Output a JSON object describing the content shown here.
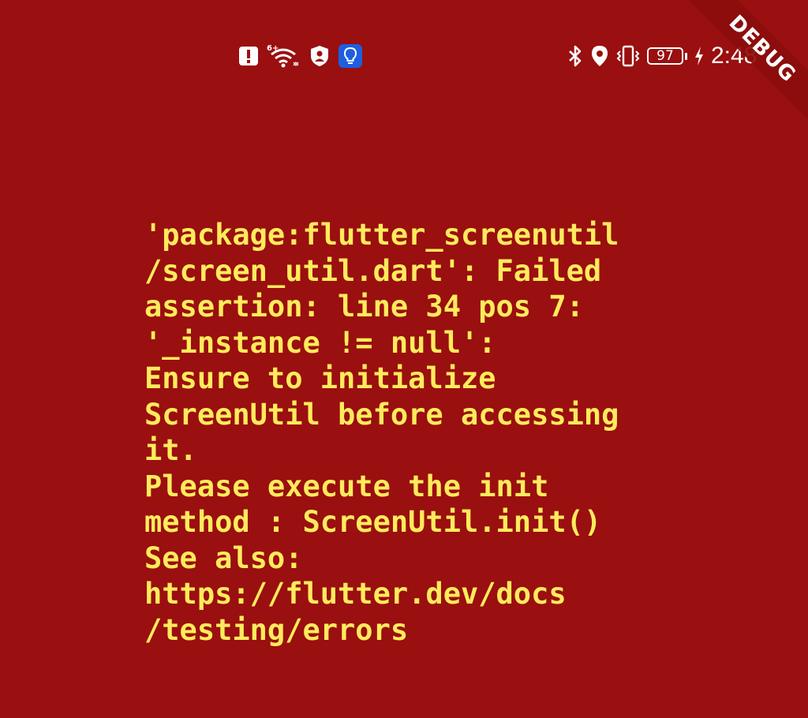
{
  "status_bar": {
    "left_icons": [
      "alert-notification-icon",
      "wifi-6-icon",
      "vpn-shield-icon",
      "tips-bulb-icon"
    ],
    "wifi_badge": "6+",
    "right_icons": [
      "bluetooth-icon",
      "location-icon",
      "vibrate-icon"
    ],
    "battery_level": "97",
    "time": "2:48",
    "colors": {
      "icon": "#ffffff",
      "bulb_badge": "#1e5fe0"
    }
  },
  "debug_banner": {
    "label": "DEBUG"
  },
  "error": {
    "lines": [
      "'package:flutter_screenutil",
      "/screen_util.dart': Failed",
      "assertion: line 34 pos 7:",
      "'_instance != null':",
      "Ensure to initialize",
      "ScreenUtil before accessing",
      "it.",
      "Please execute the init",
      "method : ScreenUtil.init()",
      "See also:",
      "https://flutter.dev/docs",
      "/testing/errors"
    ],
    "colors": {
      "background": "#9a0f0f",
      "text": "#ffeb5c"
    }
  }
}
